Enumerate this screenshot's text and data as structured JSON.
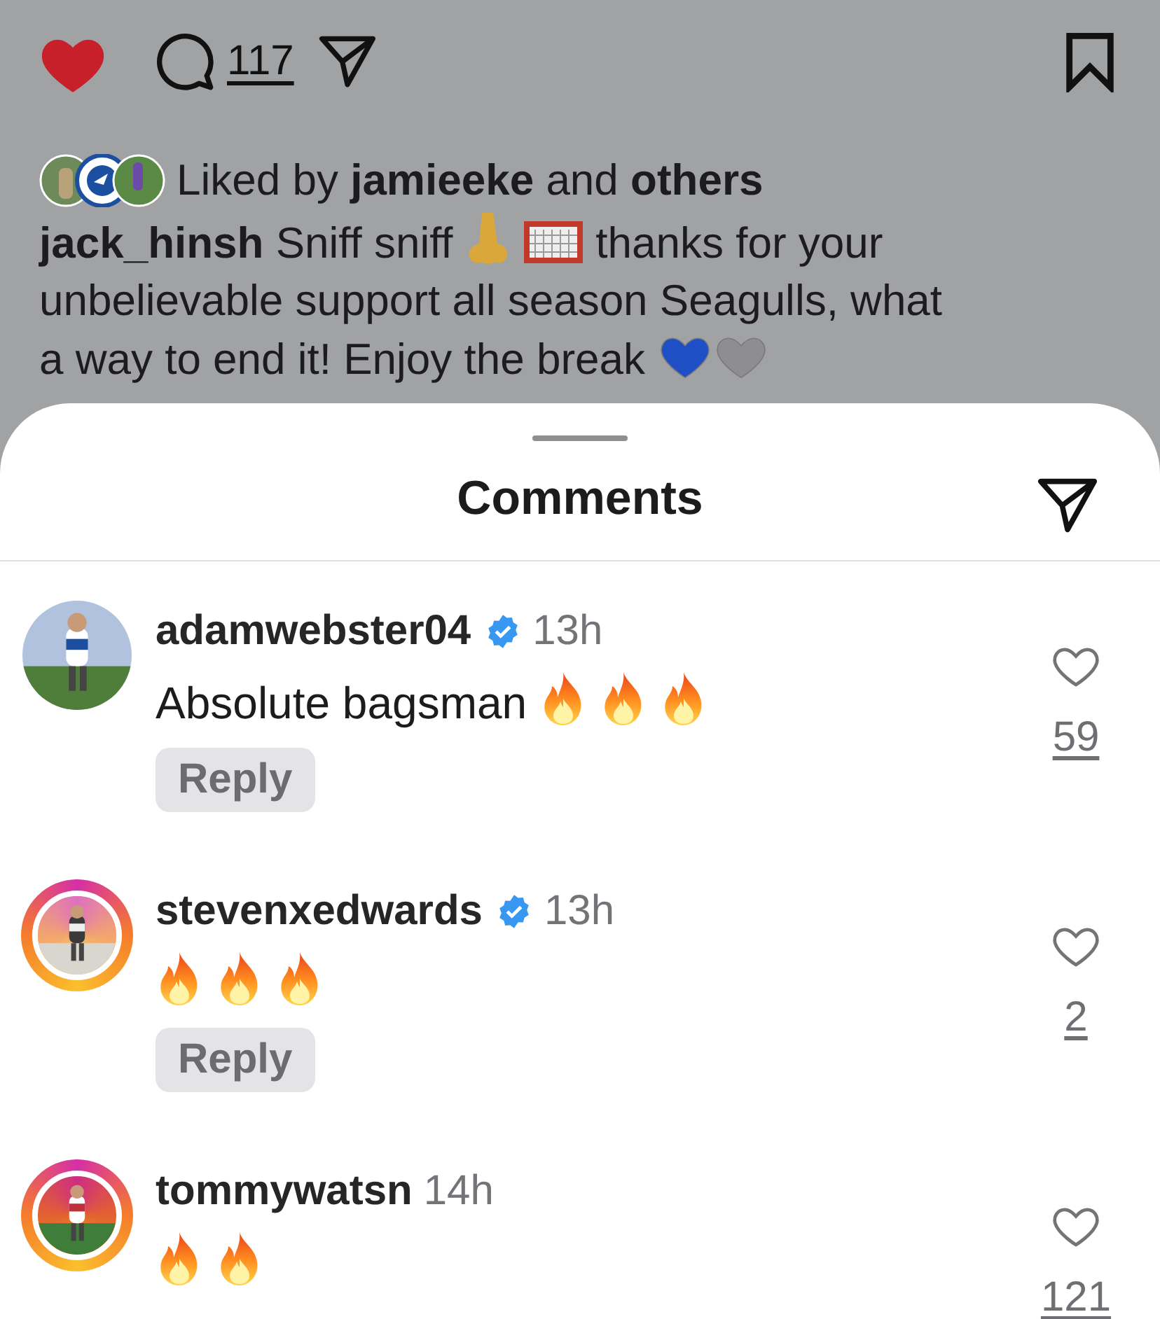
{
  "post_actions": {
    "liked": true,
    "comment_count": "117",
    "saved": false
  },
  "likes": {
    "text": "Liked by **jamieeke** and **others**"
  },
  "caption": [
    [
      {
        "kind": "bold",
        "text": "jack_hinsh"
      },
      {
        "kind": "text",
        "text": "Sniff sniff"
      },
      {
        "kind": "nose"
      },
      {
        "kind": "goal"
      },
      {
        "kind": "text",
        "text": "thanks for your"
      }
    ],
    [
      {
        "kind": "text",
        "text": "unbelievable support all season Seagulls, what"
      }
    ],
    [
      {
        "kind": "text",
        "text": "a way to end it! Enjoy the break"
      },
      {
        "kind": "heart",
        "color": "#1f4fc4"
      },
      {
        "kind": "heart",
        "color": "#8e8e90"
      }
    ]
  ],
  "sheet": {
    "title": "Comments"
  },
  "comments": [
    {
      "user": "adamwebster04",
      "verified": true,
      "story_ring": false,
      "time": "13h",
      "text": [
        {
          "kind": "text",
          "text": "Absolute bagsman"
        },
        {
          "kind": "fire"
        },
        {
          "kind": "fire"
        },
        {
          "kind": "fire"
        }
      ],
      "liked": false,
      "likes": "59",
      "reply": "Reply"
    },
    {
      "user": "stevenxedwards",
      "verified": true,
      "story_ring": true,
      "time": "13h",
      "text": [
        {
          "kind": "fire"
        },
        {
          "kind": "fire"
        },
        {
          "kind": "fire"
        }
      ],
      "liked": false,
      "likes": "2",
      "reply": "Reply"
    },
    {
      "user": "tommywatsn",
      "verified": false,
      "story_ring": true,
      "time": "14h",
      "text": [
        {
          "kind": "fire"
        },
        {
          "kind": "fire"
        }
      ],
      "liked": false,
      "likes": "121"
    }
  ]
}
